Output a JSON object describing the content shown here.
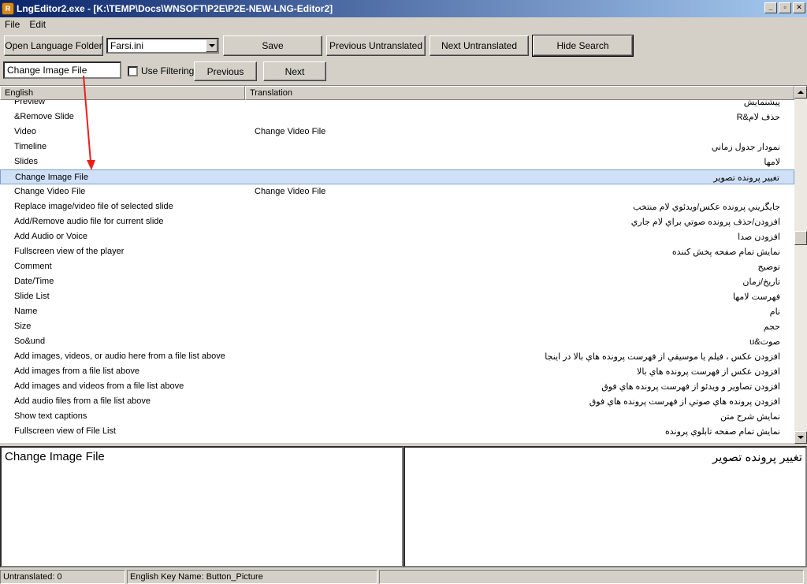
{
  "window": {
    "title": "LngEditor2.exe - [K:\\TEMP\\Docs\\WNSOFT\\P2E\\P2E-NEW-LNG-Editor2]",
    "buttons": [
      "_",
      "▫",
      "✕"
    ],
    "icon": "app-icon"
  },
  "menu": {
    "items": [
      "File",
      "Edit"
    ]
  },
  "toolbar": {
    "open_language_folder": "Open Language Folder",
    "language_file": "Farsi.ini",
    "save": "Save",
    "previous_untranslated": "Previous Untranslated",
    "next_untranslated": "Next Untranslated",
    "hide_search": "Hide Search"
  },
  "search": {
    "value": "Change Image File",
    "use_filtering_label": "Use Filtering",
    "use_filtering_checked": false,
    "previous": "Previous",
    "next": "Next"
  },
  "grid": {
    "columns": [
      "English",
      "Translation"
    ],
    "rows": [
      {
        "english": "Preview",
        "translation": "",
        "farsi": "پیشنمایش"
      },
      {
        "english": "&Remove Slide",
        "translation": "",
        "farsi": "حذف لام&R"
      },
      {
        "english": "Video",
        "translation": "Change Video File",
        "farsi": ""
      },
      {
        "english": "Timeline",
        "translation": "",
        "farsi": "نمودار جدول زماني"
      },
      {
        "english": "Slides",
        "translation": "",
        "farsi": "لامها"
      },
      {
        "english": "Change Image File",
        "translation": "",
        "farsi": "تغيير پرونده تصوير",
        "selected": true
      },
      {
        "english": "Change Video File",
        "translation": "Change Video File",
        "farsi": ""
      },
      {
        "english": "Replace image/video file of selected slide",
        "translation": "",
        "farsi": "جايگزيني پرونده عكس/ويدئوي لام منتخب"
      },
      {
        "english": "Add/Remove audio file for current slide",
        "translation": "",
        "farsi": "افزودن/حذف پرونده صوتي براي لام جاري"
      },
      {
        "english": "Add Audio or Voice",
        "translation": "",
        "farsi": "افزودن صدا"
      },
      {
        "english": "Fullscreen view of the player",
        "translation": "",
        "farsi": "نمايش تمام صفحه پخش كننده"
      },
      {
        "english": "Comment",
        "translation": "",
        "farsi": "توضيح"
      },
      {
        "english": "Date/Time",
        "translation": "",
        "farsi": "تاريخ/زمان"
      },
      {
        "english": "Slide List",
        "translation": "",
        "farsi": "فهرست لامها"
      },
      {
        "english": "Name",
        "translation": "",
        "farsi": "نام"
      },
      {
        "english": "Size",
        "translation": "",
        "farsi": "حجم"
      },
      {
        "english": "So&und",
        "translation": "",
        "farsi": "صوت&u"
      },
      {
        "english": "Add images, videos, or audio here from a file list above",
        "translation": "",
        "farsi": "افزودن عكس ، فيلم يا موسيقي از فهرست پرونده هاي بالا در اينجا"
      },
      {
        "english": "Add images from a file list above",
        "translation": "",
        "farsi": "افزودن عكس از فهرست پرونده هاي بالا"
      },
      {
        "english": "Add images and videos from a file list above",
        "translation": "",
        "farsi": "افزودن تصاوير و ويدئو از فهرست پرونده هاي فوق"
      },
      {
        "english": "Add audio files from a file list above",
        "translation": "",
        "farsi": "افزودن پرونده هاي صوتي از فهرست پرونده هاي فوق"
      },
      {
        "english": "Show text captions",
        "translation": "",
        "farsi": "نمايش شرح متن"
      },
      {
        "english": "Fullscreen view of File List",
        "translation": "",
        "farsi": "نمايش تمام صفحه تابلوي پرونده"
      }
    ]
  },
  "editor": {
    "english_text": "Change Image File",
    "translation_text": "تغيير پرونده تصوير"
  },
  "status": {
    "untranslated": "Untranslated: 0",
    "key_name": "English Key Name: Button_Picture",
    "extra": ""
  },
  "colors": {
    "titlebar_start": "#0a246a",
    "titlebar_end": "#a6caf0",
    "selection": "#cfe0f7",
    "annotation_arrow": "#e8201c"
  }
}
